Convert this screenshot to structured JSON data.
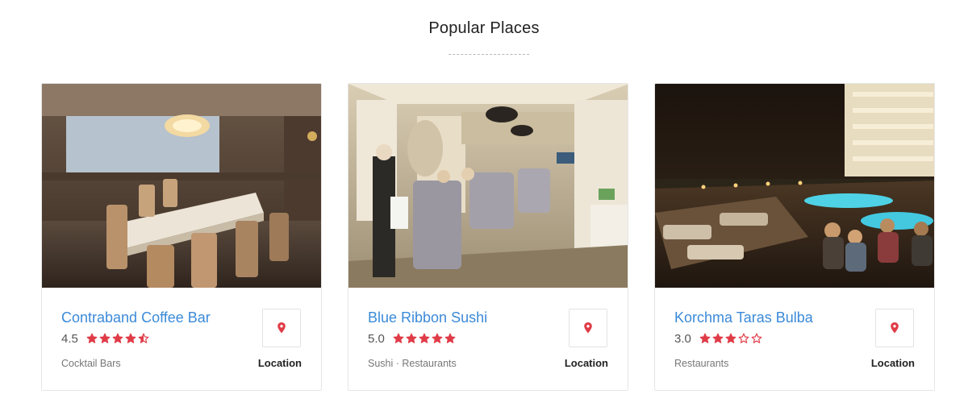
{
  "section": {
    "title": "Popular Places"
  },
  "colors": {
    "accent_link": "#3b8ad8",
    "star_red": "#e03c48",
    "pin_red": "#e03c48"
  },
  "places": [
    {
      "name": "Contraband Coffee Bar",
      "rating": "4.5",
      "rating_numeric": 4.5,
      "category": "Cocktail Bars",
      "location_label": "Location",
      "icon": "map-pin-icon"
    },
    {
      "name": "Blue Ribbon Sushi",
      "rating": "5.0",
      "rating_numeric": 5.0,
      "category": "Sushi · Restaurants",
      "location_label": "Location",
      "icon": "map-pin-icon"
    },
    {
      "name": "Korchma Taras Bulba",
      "rating": "3.0",
      "rating_numeric": 3.0,
      "category": "Restaurants",
      "location_label": "Location",
      "icon": "map-pin-icon"
    }
  ]
}
